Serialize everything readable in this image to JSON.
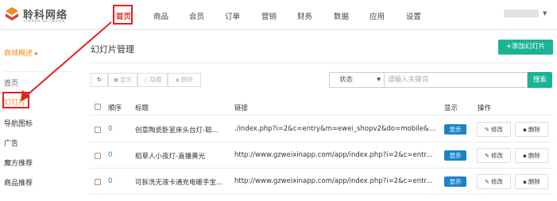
{
  "brand": {
    "name": "聆科网络",
    "sub": "LINKEN NETWORK"
  },
  "nav": {
    "items": [
      "首页",
      "商品",
      "会员",
      "订单",
      "营销",
      "财务",
      "数据",
      "应用",
      "设置"
    ],
    "active": "首页"
  },
  "sidebar": {
    "heading": "商城概述 ▸",
    "items": [
      "首页",
      "幻灯片",
      "导航图标",
      "广告",
      "魔方推荐",
      "商品推荐"
    ],
    "active": "幻灯片"
  },
  "page": {
    "title": "幻灯片管理",
    "add_label": "+添加幻灯片"
  },
  "toolbar": {
    "refresh_icon": "↻",
    "show_label": "显示",
    "hide_label": "隐藏",
    "delete_label": "删除"
  },
  "filter": {
    "status_label": "状态",
    "search_placeholder": "请输入关键词",
    "search_button": "搜索"
  },
  "table": {
    "headers": {
      "order": "顺序",
      "title": "标题",
      "link": "链接",
      "display": "显示",
      "action": "操作"
    },
    "rows": [
      {
        "order": "0",
        "title": "创意陶瓷卧室床头台灯-聪...",
        "link": "./index.php?i=2&c=entry&m=ewei_shopv2&do=mobile&...",
        "display": "显示",
        "edit": "修改",
        "delete": "删除"
      },
      {
        "order": "0",
        "title": "稻草人小夜灯-直播黄光",
        "link": "http://www.gzweixinapp.com/app/index.php?i=2&c=entr...",
        "display": "显示",
        "edit": "修改",
        "delete": "删除"
      },
      {
        "order": "0",
        "title": "可拆洗无液卡通充电暖手宝...",
        "link": "http://www.gzweixinapp.com/app/index.php?i=2&c=entr...",
        "display": "显示",
        "edit": "修改",
        "delete": "删除"
      }
    ]
  },
  "colors": {
    "accent": "#1ab394",
    "active_nav": "#e03a3a",
    "sidebar_active": "#f08c1a",
    "badge": "#1c84c6",
    "annotation": "#e02020"
  }
}
